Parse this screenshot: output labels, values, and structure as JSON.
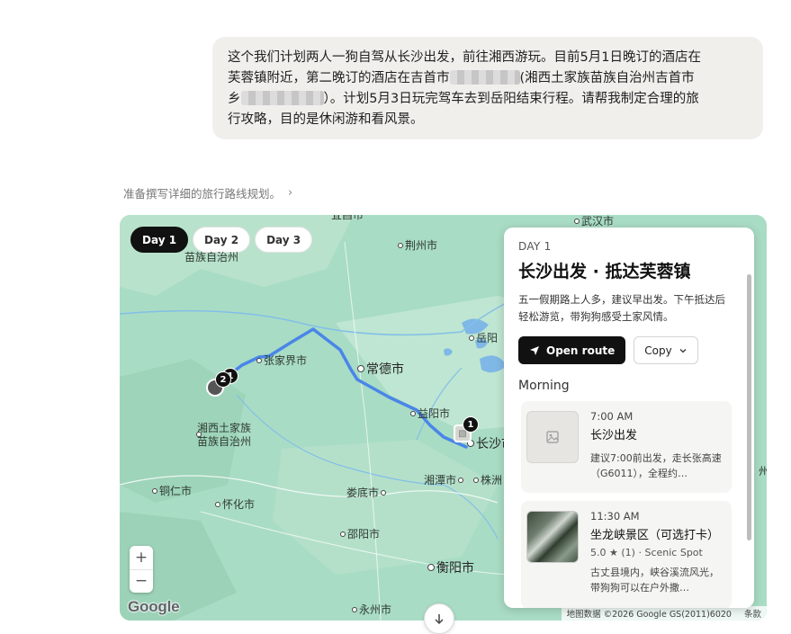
{
  "message": {
    "line1": "这个我们计划两人一狗自驾从长沙出发，前往湘西游玩。目前5月1日晚订的酒店在",
    "line2_a": "芙蓉镇附近，第二晚订的酒店在吉首市",
    "line2_b": "(湘西土家族苗族自治州吉首市",
    "line3_a": "乡",
    "line3_b": "）。计划5月3日玩完驾车去到岳阳结束行程。请帮我制定合理的旅",
    "line4": "行攻略，目的是休闲游和看风景。"
  },
  "status": {
    "text": "准备撰写详细的旅行路线规划。",
    "chevron": "›"
  },
  "map": {
    "tabs": [
      {
        "label": "Day 1",
        "active": true
      },
      {
        "label": "Day 2",
        "active": false
      },
      {
        "label": "Day 3",
        "active": false
      }
    ],
    "cities": {
      "wuhan": "武汉市",
      "jingzhou": "荆州市",
      "yueyang": "岳阳",
      "zhangjiajie": "张家界市",
      "changde": "常德市",
      "yiyang": "益阳市",
      "changsha": "长沙市",
      "xiangxi": "湘西土家族\n苗族自治州",
      "xiangxi_top": "苗族自治州",
      "tongren": "铜仁市",
      "huaihua": "怀化市",
      "loudi": "娄底市",
      "xiangtan": "湘潭市",
      "zhuzhou": "株洲",
      "shaoyang": "邵阳市",
      "hengyang": "衡阳市",
      "yongzhou": "永州市",
      "top_partial": "宜昌市",
      "right_partial": "州"
    },
    "markers": {
      "m1": "1",
      "m2": "2",
      "m1b": "1"
    },
    "route_color": "#4a86e8",
    "zoom_in": "+",
    "zoom_out": "−",
    "google_logo": "Google",
    "attribution": "地图数据 ©2026 Google GS(2011)6020",
    "terms": "条款"
  },
  "panel": {
    "day_label": "DAY 1",
    "title": "长沙出发 · 抵达芙蓉镇",
    "description": "五一假期路上人多，建议早出发。下午抵达后轻松游览，带狗狗感受土家风情。",
    "open_route": "Open route",
    "copy": "Copy",
    "section": "Morning",
    "items": [
      {
        "time": "7:00 AM",
        "name": "长沙出发",
        "meta": "",
        "text": "建议7:00前出发，走长张高速（G6011），全程约…"
      },
      {
        "time": "11:30 AM",
        "name": "坐龙峡景区（可选打卡）",
        "rating": "5.0",
        "reviews": "(1)",
        "category": "Scenic Spot",
        "text": "古丈县境内，峡谷溪流风光，带狗狗可以在户外撒…"
      }
    ]
  }
}
